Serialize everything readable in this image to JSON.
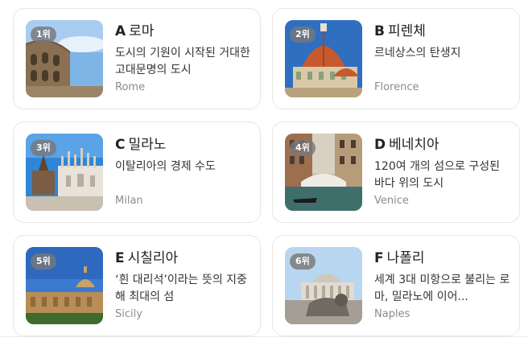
{
  "cards": [
    {
      "rank": "1위",
      "letter": "A",
      "name": "로마",
      "desc": "도시의 기원이 시작된 거대한 고대문명의 도시",
      "eng": "Rome"
    },
    {
      "rank": "2위",
      "letter": "B",
      "name": "피렌체",
      "desc": "르네상스의 탄생지",
      "eng": "Florence"
    },
    {
      "rank": "3위",
      "letter": "C",
      "name": "밀라노",
      "desc": "이탈리아의 경제 수도",
      "eng": "Milan"
    },
    {
      "rank": "4위",
      "letter": "D",
      "name": "베네치아",
      "desc": "120여 개의 섬으로 구성된 바다 위의 도시",
      "eng": "Venice"
    },
    {
      "rank": "5위",
      "letter": "E",
      "name": "시칠리아",
      "desc": "‘흰 대리석’이라는 뜻의 지중해 최대의 섬",
      "eng": "Sicily"
    },
    {
      "rank": "6위",
      "letter": "F",
      "name": "나폴리",
      "desc": "세계 3대 미항으로 불리는 로마, 밀라노에 이어...",
      "eng": "Naples"
    }
  ]
}
